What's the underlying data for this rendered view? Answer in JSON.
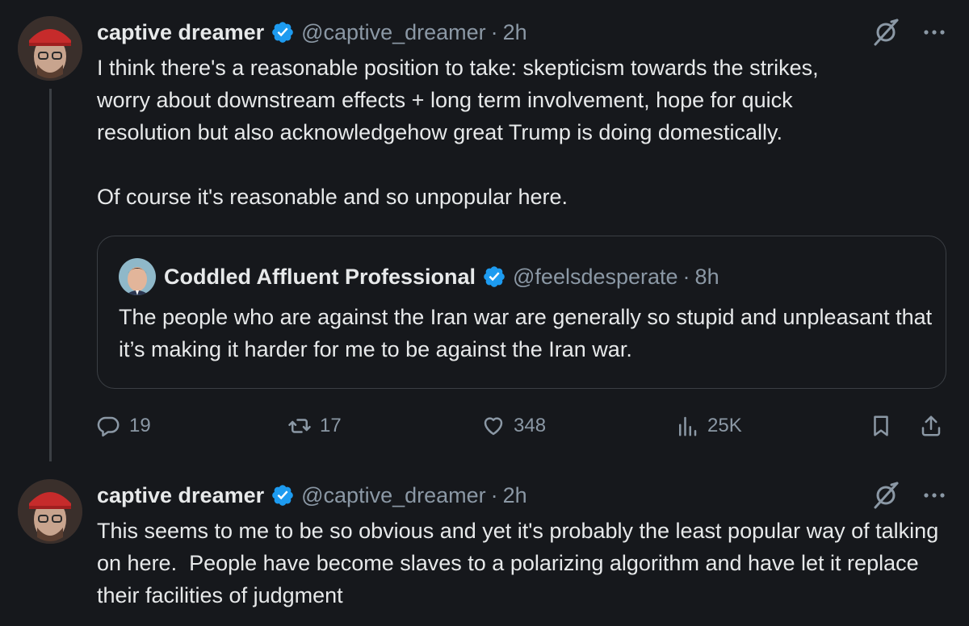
{
  "post1": {
    "author_name": "captive dreamer",
    "handle": "@captive_dreamer",
    "separator": "·",
    "time": "2h",
    "text": "I think there's a reasonable position to take: skepticism towards the strikes,\nworry about downstream effects + long term involvement, hope for quick\nresolution but also acknowledgehow great Trump is doing domestically.\n\nOf course it's reasonable and so unpopular here.",
    "quote": {
      "author_name": "Coddled Affluent Professional",
      "handle": "@feelsdesperate",
      "separator": "·",
      "time": "8h",
      "text": "The people who are against the Iran war are generally so stupid and unpleasant that it’s making it harder for me to be against the Iran war."
    },
    "actions": {
      "replies": "19",
      "reposts": "17",
      "likes": "348",
      "views": "25K"
    }
  },
  "post2": {
    "author_name": "captive dreamer",
    "handle": "@captive_dreamer",
    "separator": "·",
    "time": "2h",
    "text": "This seems to me to be so obvious and yet it's probably the least popular way of talking on here.  People have become slaves to a polarizing algorithm and have let it replace their facilities of judgment"
  },
  "icons": {
    "verified": "verified-badge-icon",
    "grok": "grok-icon",
    "more": "more-icon",
    "reply": "reply-icon",
    "repost": "repost-icon",
    "like": "like-icon",
    "views": "views-icon",
    "bookmark": "bookmark-icon",
    "share": "share-icon"
  },
  "colors": {
    "background": "#16181c",
    "text": "#e7e9ea",
    "muted": "#8b98a5",
    "verified": "#1d9bf0",
    "border": "#3b3f44"
  }
}
